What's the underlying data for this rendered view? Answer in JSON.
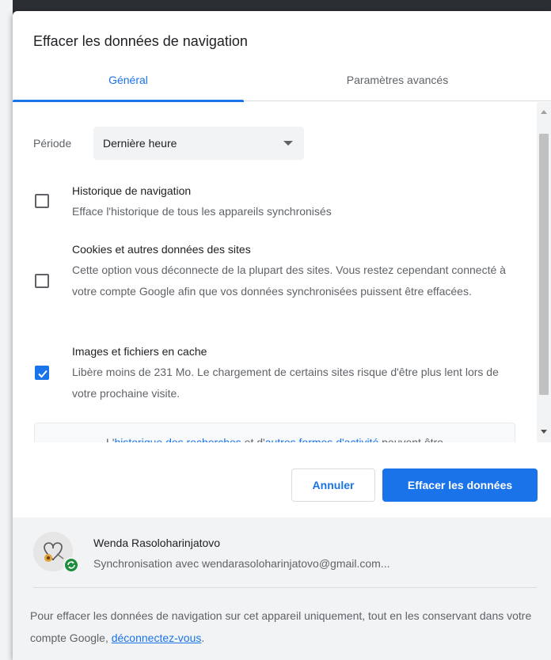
{
  "dialog": {
    "title": "Effacer les données de navigation",
    "tabs": [
      {
        "label": "Général",
        "active": true
      },
      {
        "label": "Paramètres avancés",
        "active": false
      }
    ]
  },
  "period": {
    "label": "Période",
    "value": "Dernière heure"
  },
  "options": [
    {
      "title": "Historique de navigation",
      "desc": "Efface l'historique de tous les appareils synchronisés",
      "checked": false
    },
    {
      "title": "Cookies et autres données des sites",
      "desc": "Cette option vous déconnecte de la plupart des sites. Vous restez cependant connecté à votre compte Google afin que vos données synchronisées puissent être effacées.",
      "checked": false
    },
    {
      "title": "Images et fichiers en cache",
      "desc": "Libère moins de 231 Mo. Le chargement de certains sites risque d'être plus lent lors de votre prochaine visite.",
      "checked": true
    }
  ],
  "info": {
    "prefix": "L'",
    "link1": "historique des recherches",
    "middle": " et d'",
    "link2": "autres formes d'activité",
    "suffix": " peuvent être"
  },
  "buttons": {
    "cancel": "Annuler",
    "clear": "Effacer les données"
  },
  "account": {
    "name": "Wenda Rasoloharinjatovo",
    "sync": "Synchronisation avec wendarasoloharinjatovo@gmail.com..."
  },
  "footer": {
    "text": "Pour effacer les données de navigation sur cet appareil uniquement, tout en les conservant dans votre compte Google, ",
    "link": "déconnectez-vous",
    "end": "."
  },
  "colors": {
    "accent": "#1a73e8",
    "sync_green": "#1e8e3e"
  }
}
